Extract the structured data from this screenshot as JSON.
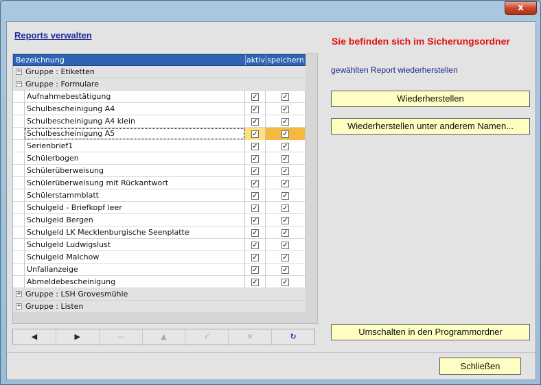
{
  "window": {
    "close_glyph": "x"
  },
  "title": "Reports verwalten",
  "status_message": "Sie befinden sich im Sicherungsordner",
  "hint": "gewählten Report wiederherstellen",
  "buttons": {
    "restore": "Wiederherstellen",
    "restore_as": "Wiederherstellen unter anderem Namen...",
    "switch_folder": "Umschalten in den Programmordner",
    "close": "Schließen"
  },
  "grid": {
    "columns": [
      "Bezeichnung",
      "aktiv",
      "speichern"
    ],
    "groups": [
      {
        "label": "Gruppe : Etiketten",
        "expanded": false,
        "items": []
      },
      {
        "label": "Gruppe : Formulare",
        "expanded": true,
        "items": [
          {
            "name": "Aufnahmebestätigung",
            "aktiv": true,
            "speichern": true
          },
          {
            "name": "Schulbescheinigung A4",
            "aktiv": true,
            "speichern": true
          },
          {
            "name": "Schulbescheinigung A4 klein",
            "aktiv": true,
            "speichern": true
          },
          {
            "name": "Schulbescheinigung A5",
            "aktiv": true,
            "speichern": true,
            "selected": true
          },
          {
            "name": "Serienbrief1",
            "aktiv": true,
            "speichern": true
          },
          {
            "name": "Schülerbogen",
            "aktiv": true,
            "speichern": true
          },
          {
            "name": "Schülerüberweisung",
            "aktiv": true,
            "speichern": true
          },
          {
            "name": "Schülerüberweisung mit Rückantwort",
            "aktiv": true,
            "speichern": true
          },
          {
            "name": "Schülerstammblatt",
            "aktiv": true,
            "speichern": true
          },
          {
            "name": "Schulgeld - Briefkopf leer",
            "aktiv": true,
            "speichern": true
          },
          {
            "name": "Schulgeld Bergen",
            "aktiv": true,
            "speichern": true
          },
          {
            "name": "Schulgeld LK Mecklenburgische Seenplatte",
            "aktiv": true,
            "speichern": true
          },
          {
            "name": "Schulgeld Ludwigslust",
            "aktiv": true,
            "speichern": true
          },
          {
            "name": "Schulgeld Malchow",
            "aktiv": true,
            "speichern": true
          },
          {
            "name": "Unfallanzeige",
            "aktiv": true,
            "speichern": true
          },
          {
            "name": "Abmeldebescheinigung",
            "aktiv": true,
            "speichern": true
          }
        ]
      },
      {
        "label": "Gruppe : LSH Grovesmühle",
        "expanded": false,
        "items": []
      },
      {
        "label": "Gruppe : Listen",
        "expanded": false,
        "items": []
      }
    ]
  },
  "navigator": [
    {
      "name": "nav-prior-button",
      "glyph": "◀",
      "enabled": true
    },
    {
      "name": "nav-next-button",
      "glyph": "▶",
      "enabled": true
    },
    {
      "name": "nav-delete-button",
      "glyph": "—",
      "enabled": false
    },
    {
      "name": "nav-up-button",
      "glyph": "▲",
      "enabled": false
    },
    {
      "name": "nav-post-button",
      "glyph": "✓",
      "enabled": false
    },
    {
      "name": "nav-cancel-button",
      "glyph": "✕",
      "enabled": false
    },
    {
      "name": "nav-refresh-button",
      "glyph": "↻",
      "enabled": true
    }
  ]
}
